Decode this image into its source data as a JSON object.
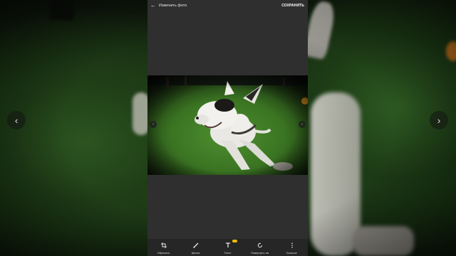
{
  "header": {
    "back_icon": "arrow-left-icon",
    "title": "Изменить фото",
    "save_label": "СОХРАНИТЬ"
  },
  "toolbar": {
    "items": [
      {
        "label": "Обрезать",
        "icon": "crop-icon"
      },
      {
        "label": "Щетка",
        "icon": "brush-icon"
      },
      {
        "label": "Текст",
        "icon": "text-icon",
        "badge": true
      },
      {
        "label": "Повернуть на",
        "icon": "rotate-icon"
      },
      {
        "label": "Больше",
        "icon": "more-vertical-icon"
      }
    ]
  },
  "colors": {
    "panel_bg": "#2f2f2f",
    "toolbar_bg": "#262626",
    "badge": "#f2b600",
    "text": "#e6e6e6"
  },
  "photo": {
    "subject": "photo"
  }
}
